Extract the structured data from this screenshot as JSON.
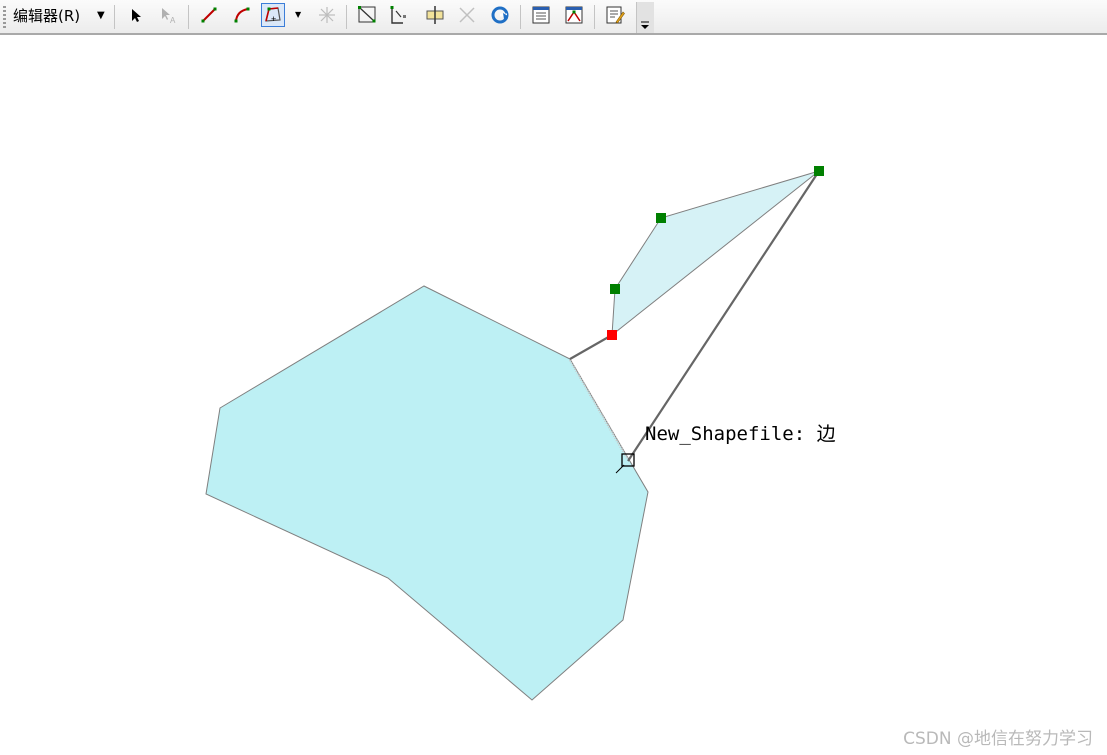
{
  "toolbar": {
    "editor_menu": "编辑器(R)",
    "buttons": [
      {
        "name": "edit-tool-icon",
        "enabled": true
      },
      {
        "name": "edit-annotation-tool-icon",
        "enabled": false
      },
      {
        "name": "straight-segment-icon",
        "enabled": true
      },
      {
        "name": "endpoint-arc-segment-icon",
        "enabled": true
      },
      {
        "name": "trace-tool-icon",
        "enabled": true,
        "active": true
      },
      {
        "name": "point-tool-icon",
        "enabled": false
      },
      {
        "name": "edit-vertices-icon",
        "enabled": true
      },
      {
        "name": "reshape-feature-icon",
        "enabled": true
      },
      {
        "name": "cut-polygons-icon",
        "enabled": true
      },
      {
        "name": "split-tool-icon",
        "enabled": false
      },
      {
        "name": "rotate-tool-icon",
        "enabled": true
      },
      {
        "name": "attributes-icon",
        "enabled": true
      },
      {
        "name": "sketch-properties-icon",
        "enabled": true
      },
      {
        "name": "create-features-icon",
        "enabled": true
      }
    ]
  },
  "map": {
    "polygon_fill": "#bdf0f4",
    "polygon_stroke": "#7f7f7f",
    "vertex_color": "#008000",
    "current_vertex_color": "#ff0000",
    "snap_tip": "New_Shapefile: 边"
  },
  "watermark": "CSDN @地信在努力学习"
}
